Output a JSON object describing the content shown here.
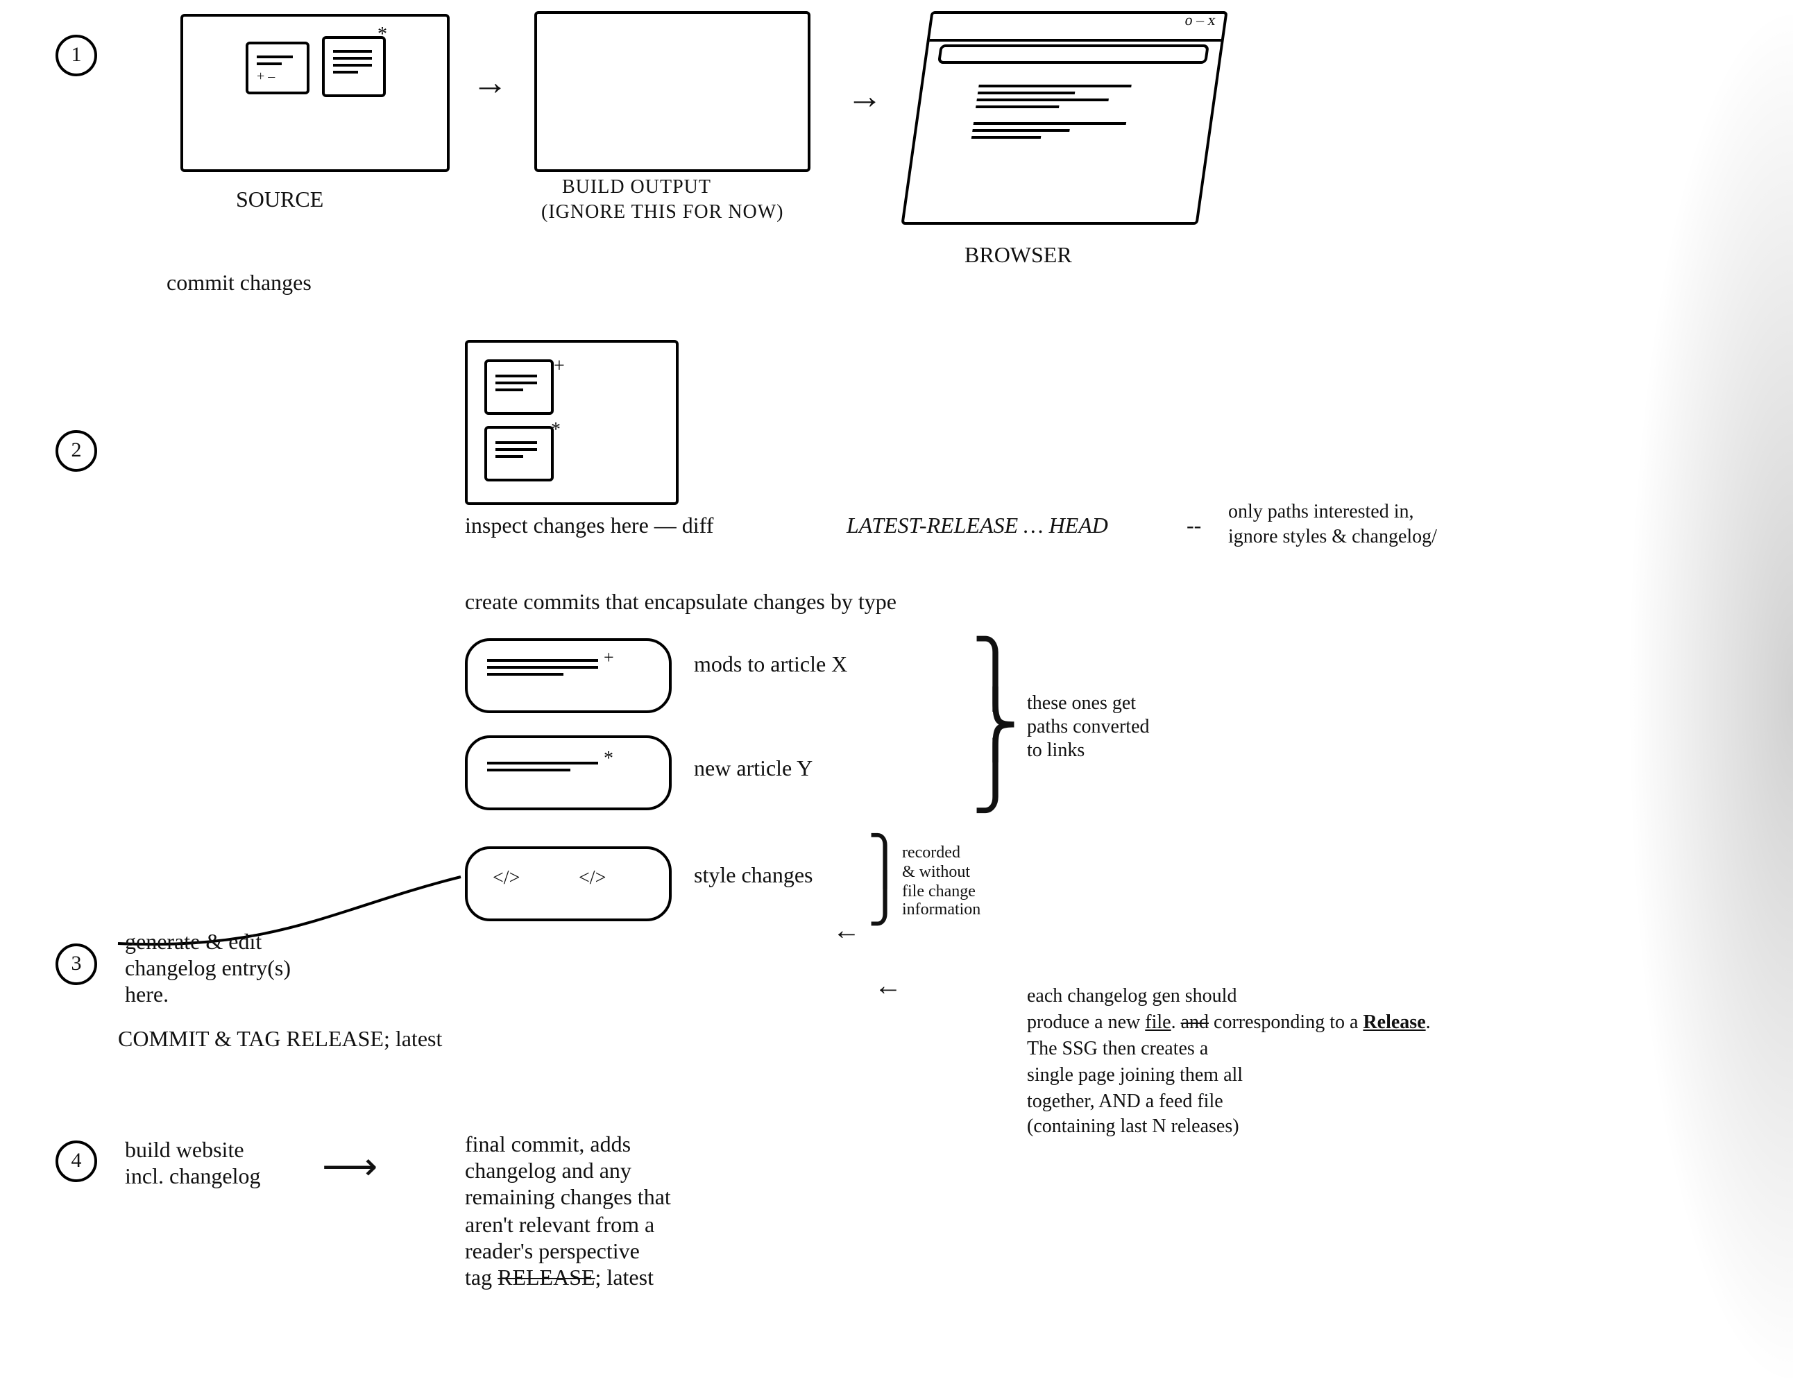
{
  "steps": {
    "n1": "1",
    "n2": "2",
    "n3": "3",
    "n4": "4"
  },
  "row1": {
    "source_label": "SOURCE",
    "build_label_line1": "BUILD OUTPUT",
    "build_label_line2": "(IGNORE THIS FOR NOW)",
    "browser_label": "BROWSER",
    "commit_changes": "commit changes",
    "arrow1": "→",
    "arrow2": "→",
    "browser_controls": "o  –  x"
  },
  "row2": {
    "inspect_line": "inspect changes here — diff",
    "diff_range": "LATEST-RELEASE … HEAD",
    "diff_note_dash": "--",
    "diff_note_line1": "only paths interested in,",
    "diff_note_line2": "ignore styles & changelog/",
    "create_commits": "create commits that encapsulate changes by type",
    "commit_a_label": "mods to article X",
    "commit_b_label": "new article Y",
    "commit_c_label": "style changes",
    "brace1_note_line1": "these ones get",
    "brace1_note_line2": "paths converted",
    "brace1_note_line3": "to links",
    "brace2_note_line1": "recorded",
    "brace2_note_line2": "& without",
    "brace2_note_line3": "file change",
    "brace2_note_line4": "information",
    "code_glyph": "</>",
    "plus": "+",
    "star": "*"
  },
  "row3": {
    "gen_line1": "generate & edit",
    "gen_line2": "changelog entry(s)",
    "gen_line3": "here.",
    "commit_tag": "COMMIT & TAG RELEASE; latest",
    "back_arrow": "←",
    "side_note_l1": "each changelog gen should",
    "side_note_l2_a": "produce a new",
    "side_note_l2_file": "file",
    "side_note_l2_b": ".",
    "side_note_l2_strike": "and",
    "side_note_l2_c": "corresponding to a",
    "side_note_l2_release": "Release",
    "side_note_l2_d": ".",
    "side_note_l3": "The SSG then creates a",
    "side_note_l4": "single page joining them all",
    "side_note_l5": "together, AND a feed file",
    "side_note_l6": "(containing last N releases)"
  },
  "row4": {
    "build_line1": "build website",
    "build_line2": "incl. changelog",
    "arrow": "⟶",
    "final_l1": "final commit, adds",
    "final_l2": "changelog and any",
    "final_l3": "remaining changes that",
    "final_l4": "aren't relevant from a",
    "final_l5": "reader's perspective",
    "final_l6_a": "tag ",
    "final_l6_strike": "RELEASE",
    "final_l6_b": "; latest"
  }
}
